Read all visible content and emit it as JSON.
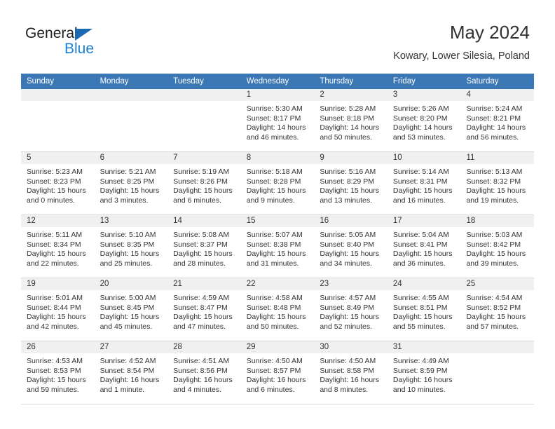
{
  "brand": {
    "name_dark": "General",
    "name_blue": "Blue",
    "color_dark": "#231f20",
    "color_blue": "#1b7fd4",
    "triangle_color": "#1b69b2"
  },
  "header": {
    "title": "May 2024",
    "subtitle": "Kowary, Lower Silesia, Poland"
  },
  "theme": {
    "header_blue": "#3b76b5",
    "daynum_band": "#f0f0f0",
    "row_divider": "#d9d9d9",
    "text": "#333333"
  },
  "weekdays": [
    "Sunday",
    "Monday",
    "Tuesday",
    "Wednesday",
    "Thursday",
    "Friday",
    "Saturday"
  ],
  "weeks": [
    [
      {
        "day": ""
      },
      {
        "day": ""
      },
      {
        "day": ""
      },
      {
        "day": "1",
        "sunrise": "Sunrise: 5:30 AM",
        "sunset": "Sunset: 8:17 PM",
        "daylight_l1": "Daylight: 14 hours",
        "daylight_l2": "and 46 minutes."
      },
      {
        "day": "2",
        "sunrise": "Sunrise: 5:28 AM",
        "sunset": "Sunset: 8:18 PM",
        "daylight_l1": "Daylight: 14 hours",
        "daylight_l2": "and 50 minutes."
      },
      {
        "day": "3",
        "sunrise": "Sunrise: 5:26 AM",
        "sunset": "Sunset: 8:20 PM",
        "daylight_l1": "Daylight: 14 hours",
        "daylight_l2": "and 53 minutes."
      },
      {
        "day": "4",
        "sunrise": "Sunrise: 5:24 AM",
        "sunset": "Sunset: 8:21 PM",
        "daylight_l1": "Daylight: 14 hours",
        "daylight_l2": "and 56 minutes."
      }
    ],
    [
      {
        "day": "5",
        "sunrise": "Sunrise: 5:23 AM",
        "sunset": "Sunset: 8:23 PM",
        "daylight_l1": "Daylight: 15 hours",
        "daylight_l2": "and 0 minutes."
      },
      {
        "day": "6",
        "sunrise": "Sunrise: 5:21 AM",
        "sunset": "Sunset: 8:25 PM",
        "daylight_l1": "Daylight: 15 hours",
        "daylight_l2": "and 3 minutes."
      },
      {
        "day": "7",
        "sunrise": "Sunrise: 5:19 AM",
        "sunset": "Sunset: 8:26 PM",
        "daylight_l1": "Daylight: 15 hours",
        "daylight_l2": "and 6 minutes."
      },
      {
        "day": "8",
        "sunrise": "Sunrise: 5:18 AM",
        "sunset": "Sunset: 8:28 PM",
        "daylight_l1": "Daylight: 15 hours",
        "daylight_l2": "and 9 minutes."
      },
      {
        "day": "9",
        "sunrise": "Sunrise: 5:16 AM",
        "sunset": "Sunset: 8:29 PM",
        "daylight_l1": "Daylight: 15 hours",
        "daylight_l2": "and 13 minutes."
      },
      {
        "day": "10",
        "sunrise": "Sunrise: 5:14 AM",
        "sunset": "Sunset: 8:31 PM",
        "daylight_l1": "Daylight: 15 hours",
        "daylight_l2": "and 16 minutes."
      },
      {
        "day": "11",
        "sunrise": "Sunrise: 5:13 AM",
        "sunset": "Sunset: 8:32 PM",
        "daylight_l1": "Daylight: 15 hours",
        "daylight_l2": "and 19 minutes."
      }
    ],
    [
      {
        "day": "12",
        "sunrise": "Sunrise: 5:11 AM",
        "sunset": "Sunset: 8:34 PM",
        "daylight_l1": "Daylight: 15 hours",
        "daylight_l2": "and 22 minutes."
      },
      {
        "day": "13",
        "sunrise": "Sunrise: 5:10 AM",
        "sunset": "Sunset: 8:35 PM",
        "daylight_l1": "Daylight: 15 hours",
        "daylight_l2": "and 25 minutes."
      },
      {
        "day": "14",
        "sunrise": "Sunrise: 5:08 AM",
        "sunset": "Sunset: 8:37 PM",
        "daylight_l1": "Daylight: 15 hours",
        "daylight_l2": "and 28 minutes."
      },
      {
        "day": "15",
        "sunrise": "Sunrise: 5:07 AM",
        "sunset": "Sunset: 8:38 PM",
        "daylight_l1": "Daylight: 15 hours",
        "daylight_l2": "and 31 minutes."
      },
      {
        "day": "16",
        "sunrise": "Sunrise: 5:05 AM",
        "sunset": "Sunset: 8:40 PM",
        "daylight_l1": "Daylight: 15 hours",
        "daylight_l2": "and 34 minutes."
      },
      {
        "day": "17",
        "sunrise": "Sunrise: 5:04 AM",
        "sunset": "Sunset: 8:41 PM",
        "daylight_l1": "Daylight: 15 hours",
        "daylight_l2": "and 36 minutes."
      },
      {
        "day": "18",
        "sunrise": "Sunrise: 5:03 AM",
        "sunset": "Sunset: 8:42 PM",
        "daylight_l1": "Daylight: 15 hours",
        "daylight_l2": "and 39 minutes."
      }
    ],
    [
      {
        "day": "19",
        "sunrise": "Sunrise: 5:01 AM",
        "sunset": "Sunset: 8:44 PM",
        "daylight_l1": "Daylight: 15 hours",
        "daylight_l2": "and 42 minutes."
      },
      {
        "day": "20",
        "sunrise": "Sunrise: 5:00 AM",
        "sunset": "Sunset: 8:45 PM",
        "daylight_l1": "Daylight: 15 hours",
        "daylight_l2": "and 45 minutes."
      },
      {
        "day": "21",
        "sunrise": "Sunrise: 4:59 AM",
        "sunset": "Sunset: 8:47 PM",
        "daylight_l1": "Daylight: 15 hours",
        "daylight_l2": "and 47 minutes."
      },
      {
        "day": "22",
        "sunrise": "Sunrise: 4:58 AM",
        "sunset": "Sunset: 8:48 PM",
        "daylight_l1": "Daylight: 15 hours",
        "daylight_l2": "and 50 minutes."
      },
      {
        "day": "23",
        "sunrise": "Sunrise: 4:57 AM",
        "sunset": "Sunset: 8:49 PM",
        "daylight_l1": "Daylight: 15 hours",
        "daylight_l2": "and 52 minutes."
      },
      {
        "day": "24",
        "sunrise": "Sunrise: 4:55 AM",
        "sunset": "Sunset: 8:51 PM",
        "daylight_l1": "Daylight: 15 hours",
        "daylight_l2": "and 55 minutes."
      },
      {
        "day": "25",
        "sunrise": "Sunrise: 4:54 AM",
        "sunset": "Sunset: 8:52 PM",
        "daylight_l1": "Daylight: 15 hours",
        "daylight_l2": "and 57 minutes."
      }
    ],
    [
      {
        "day": "26",
        "sunrise": "Sunrise: 4:53 AM",
        "sunset": "Sunset: 8:53 PM",
        "daylight_l1": "Daylight: 15 hours",
        "daylight_l2": "and 59 minutes."
      },
      {
        "day": "27",
        "sunrise": "Sunrise: 4:52 AM",
        "sunset": "Sunset: 8:54 PM",
        "daylight_l1": "Daylight: 16 hours",
        "daylight_l2": "and 1 minute."
      },
      {
        "day": "28",
        "sunrise": "Sunrise: 4:51 AM",
        "sunset": "Sunset: 8:56 PM",
        "daylight_l1": "Daylight: 16 hours",
        "daylight_l2": "and 4 minutes."
      },
      {
        "day": "29",
        "sunrise": "Sunrise: 4:50 AM",
        "sunset": "Sunset: 8:57 PM",
        "daylight_l1": "Daylight: 16 hours",
        "daylight_l2": "and 6 minutes."
      },
      {
        "day": "30",
        "sunrise": "Sunrise: 4:50 AM",
        "sunset": "Sunset: 8:58 PM",
        "daylight_l1": "Daylight: 16 hours",
        "daylight_l2": "and 8 minutes."
      },
      {
        "day": "31",
        "sunrise": "Sunrise: 4:49 AM",
        "sunset": "Sunset: 8:59 PM",
        "daylight_l1": "Daylight: 16 hours",
        "daylight_l2": "and 10 minutes."
      },
      {
        "day": ""
      }
    ]
  ]
}
